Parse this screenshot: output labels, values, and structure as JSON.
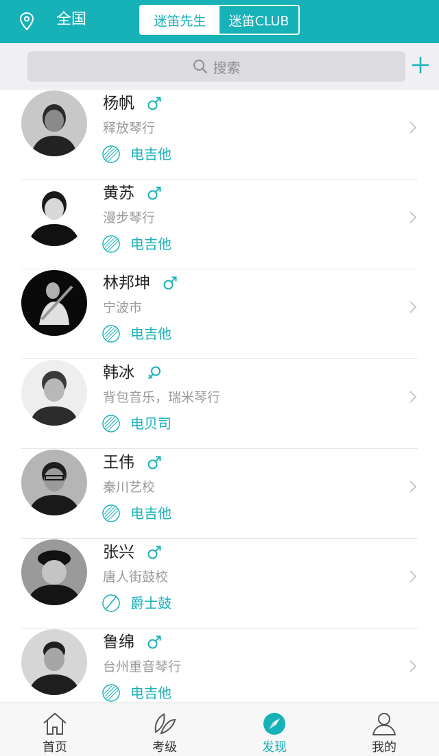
{
  "header": {
    "location": "全国",
    "segments": [
      "迷笛先生",
      "迷笛CLUB"
    ]
  },
  "search": {
    "placeholder": "搜索"
  },
  "colors": {
    "accent": "#17b1b8",
    "text": "#222222",
    "muted": "#9a9a9a"
  },
  "teachers": [
    {
      "name": "杨帆",
      "gender": "male",
      "org": "释放琴行",
      "instrument": "电吉他",
      "instrument_icon": "hatched-circle-icon"
    },
    {
      "name": "黄苏",
      "gender": "male",
      "org": "漫步琴行",
      "instrument": "电吉他",
      "instrument_icon": "hatched-circle-icon"
    },
    {
      "name": "林邦坤",
      "gender": "male",
      "org": "宁波市",
      "instrument": "电吉他",
      "instrument_icon": "hatched-circle-icon"
    },
    {
      "name": "韩冰",
      "gender": "female",
      "org": "背包音乐，瑞米琴行",
      "instrument": "电贝司",
      "instrument_icon": "hatched-circle-icon"
    },
    {
      "name": "王伟",
      "gender": "male",
      "org": "秦川艺校",
      "instrument": "电吉他",
      "instrument_icon": "hatched-circle-icon"
    },
    {
      "name": "张兴",
      "gender": "male",
      "org": "唐人街鼓校",
      "instrument": "爵士鼓",
      "instrument_icon": "drumstick-circle-icon"
    },
    {
      "name": "鲁绵",
      "gender": "male",
      "org": "台州重音琴行",
      "instrument": "电吉他",
      "instrument_icon": "hatched-circle-icon"
    }
  ],
  "tabs": [
    {
      "label": "首页",
      "icon": "home-icon",
      "active": false
    },
    {
      "label": "考级",
      "icon": "exam-leaf-icon",
      "active": false
    },
    {
      "label": "发现",
      "icon": "compass-icon",
      "active": true
    },
    {
      "label": "我的",
      "icon": "user-icon",
      "active": false
    }
  ]
}
